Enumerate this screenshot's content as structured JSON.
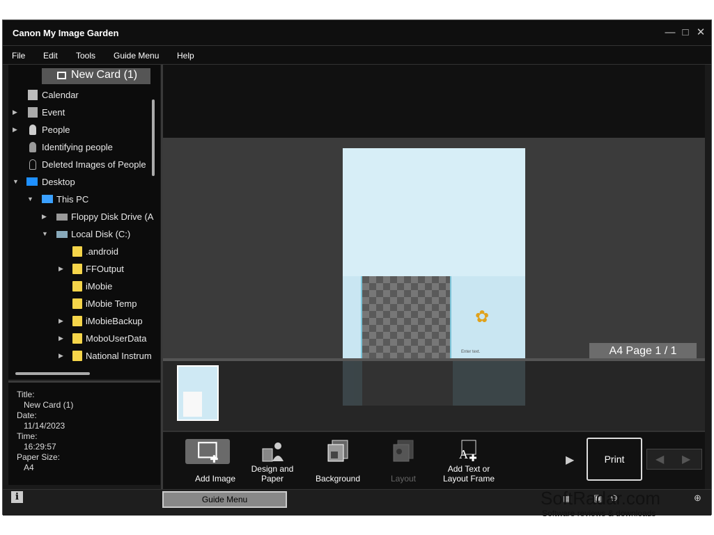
{
  "window": {
    "title": "Canon My Image Garden",
    "minimize": "—",
    "maximize": "□",
    "close": "✕"
  },
  "menu": [
    "File",
    "Edit",
    "Tools",
    "Guide Menu",
    "Help"
  ],
  "tree": {
    "selected": "New Card (1)",
    "items": [
      {
        "label": "Calendar",
        "icon": "calendar-icon"
      },
      {
        "label": "Event",
        "icon": "event-icon",
        "expander": "▶"
      },
      {
        "label": "People",
        "icon": "person-icon",
        "expander": "▶"
      },
      {
        "label": "Identifying people",
        "icon": "identify-person-icon"
      },
      {
        "label": "Deleted Images of People",
        "icon": "deleted-person-icon"
      },
      {
        "label": "Desktop",
        "icon": "desktop-icon",
        "expander": "▼"
      },
      {
        "label": "This PC",
        "icon": "pc-icon",
        "expander": "▼"
      },
      {
        "label": "Floppy Disk Drive (A",
        "icon": "floppy-drive-icon",
        "expander": "▶"
      },
      {
        "label": "Local Disk (C:)",
        "icon": "local-disk-icon",
        "expander": "▼"
      },
      {
        "label": ".android",
        "icon": "folder-icon"
      },
      {
        "label": "FFOutput",
        "icon": "folder-icon",
        "expander": "▶"
      },
      {
        "label": "iMobie",
        "icon": "folder-icon"
      },
      {
        "label": "iMobie Temp",
        "icon": "folder-icon"
      },
      {
        "label": "iMobieBackup",
        "icon": "folder-icon",
        "expander": "▶"
      },
      {
        "label": "MoboUserData",
        "icon": "folder-icon",
        "expander": "▶"
      },
      {
        "label": "National Instrum",
        "icon": "folder-icon",
        "expander": "▶"
      }
    ]
  },
  "info": {
    "title_label": "Title:",
    "title_value": "New Card (1)",
    "date_label": "Date:",
    "date_value": "11/14/2023",
    "time_label": "Time:",
    "time_value": "16:29:57",
    "paper_label": "Paper Size:",
    "paper_value": "A4"
  },
  "canvas": {
    "page_indicator": "A4 Page 1 / 1",
    "card_placeholder": "Enter text."
  },
  "toolbar": {
    "add_image": "Add Image",
    "design_paper_1": "Design and",
    "design_paper_2": "Paper",
    "background": "Background",
    "layout": "Layout",
    "add_text_1": "Add Text or",
    "add_text_2": "Layout Frame",
    "print": "Print",
    "more": "▶",
    "prev": "◀",
    "next": "▶"
  },
  "status": {
    "info": "i",
    "guide_menu": "Guide Menu"
  },
  "watermark": {
    "name": "SoftRadar.com",
    "tagline": "Software reviews & downloads"
  }
}
